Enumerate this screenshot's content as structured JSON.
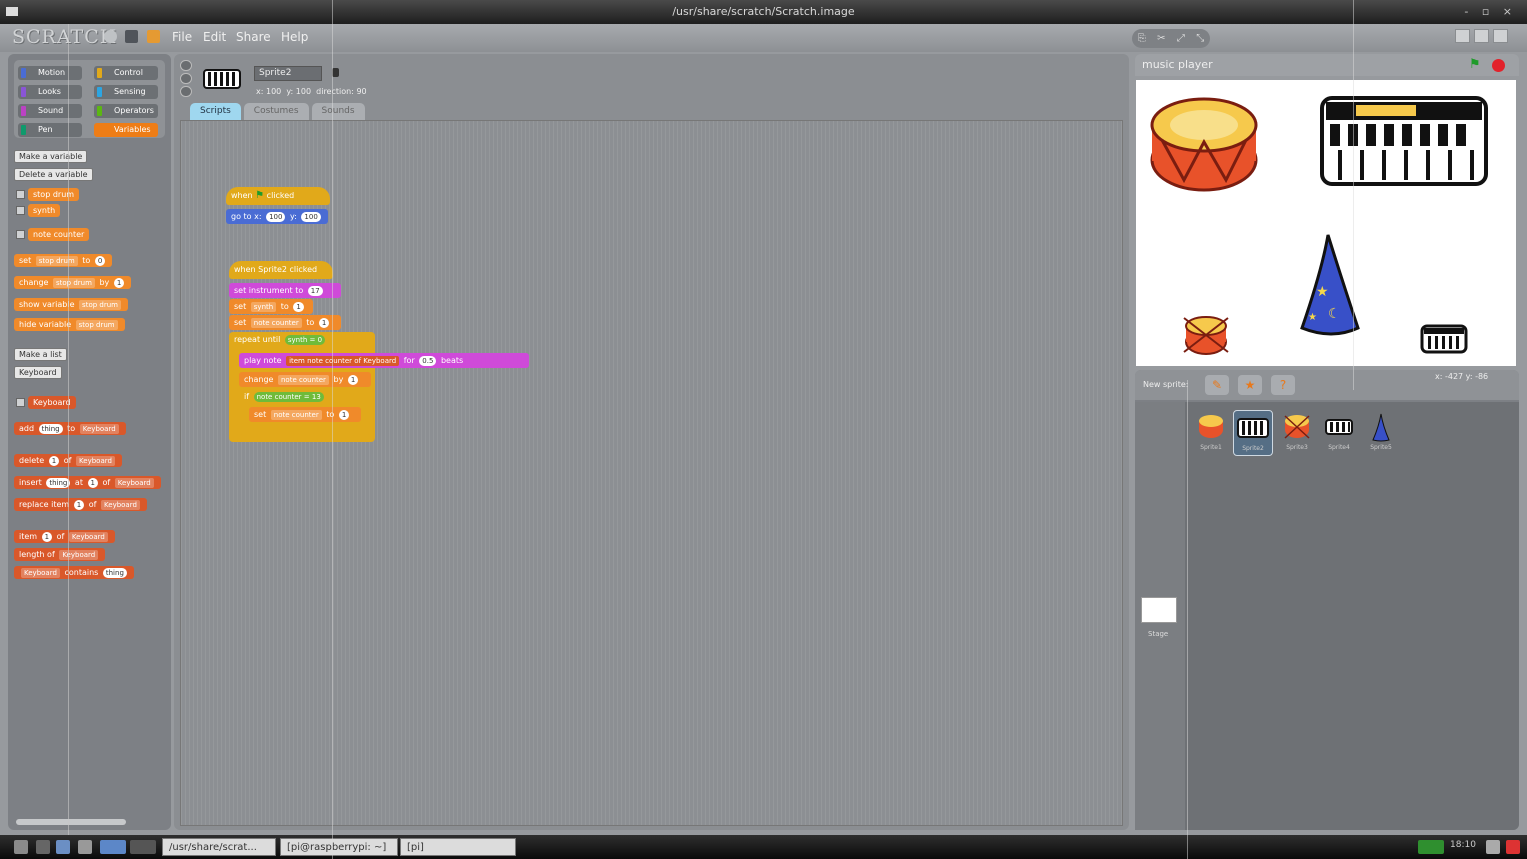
{
  "window": {
    "title": "/usr/share/scratch/Scratch.image"
  },
  "app": {
    "logo": "SCRATCH"
  },
  "menu": {
    "items": [
      "File",
      "Edit",
      "Share",
      "Help"
    ]
  },
  "categories": [
    {
      "label": "Motion",
      "color": "#4a6cd4"
    },
    {
      "label": "Control",
      "color": "#e1a91a"
    },
    {
      "label": "Looks",
      "color": "#8a55d7"
    },
    {
      "label": "Sensing",
      "color": "#2ca5e2"
    },
    {
      "label": "Sound",
      "color": "#bb42c3"
    },
    {
      "label": "Operators",
      "color": "#5cb712"
    },
    {
      "label": "Pen",
      "color": "#0e9a6c"
    },
    {
      "label": "Variables",
      "color": "#ee7d16"
    }
  ],
  "palette": {
    "make_variable": "Make a variable",
    "delete_variable": "Delete a variable",
    "vars": [
      "stop drum",
      "synth",
      "note counter"
    ],
    "set_block": "set",
    "set_var": "stop drum",
    "set_to": "to",
    "set_val": "0",
    "change_block": "change",
    "change_var": "stop drum",
    "change_by": "by",
    "change_val": "1",
    "show_block": "show variable",
    "show_var": "stop drum",
    "hide_block": "hide variable",
    "hide_var": "stop drum",
    "make_list": "Make a list",
    "delete_list": "Keyboard",
    "list_name": "Keyboard",
    "add_block": "add",
    "add_thing": "thing",
    "add_to": "to",
    "add_list": "Keyboard",
    "delete_block": "delete",
    "delete_idx": "1",
    "delete_of": "of",
    "insert_block": "insert",
    "insert_thing": "thing",
    "insert_at": "at",
    "insert_idx": "1",
    "insert_of": "of",
    "insert_list": "Keyboard",
    "replace_block": "replace item",
    "replace_idx": "1",
    "replace_of": "of",
    "replace_list": "Keyboard",
    "item_block": "item",
    "item_idx": "1",
    "item_of": "of",
    "item_list": "Keyboard",
    "length_block": "length of",
    "length_list": "Keyboard",
    "contains_list": "Keyboard",
    "contains_block": "contains",
    "contains_thing": "thing"
  },
  "sprite": {
    "name": "Sprite2",
    "x_label": "x:",
    "x_val": "100",
    "y_label": "y:",
    "y_val": "100",
    "dir_label": "direction:",
    "dir_val": "90"
  },
  "tabs": [
    "Scripts",
    "Costumes",
    "Sounds"
  ],
  "script": {
    "when_flag": "when",
    "flag_clicked": "clicked",
    "goto": "go to x:",
    "goto_x": "100",
    "goto_y_label": "y:",
    "goto_y": "100",
    "when_sprite": "when Sprite2 clicked",
    "set_instrument": "set instrument to",
    "instrument": "17",
    "set1": "set",
    "set1_var": "synth",
    "set1_to": "to",
    "set1_val": "1",
    "set2": "set",
    "set2_var": "note counter",
    "set2_to": "to",
    "set2_val": "1",
    "repeat_until": "repeat until",
    "repeat_var": "synth",
    "repeat_eq": "=",
    "repeat_val": "0",
    "play_note": "play note",
    "item": "item",
    "note_counter": "note counter",
    "of": "of",
    "list": "Keyboard",
    "for": "for",
    "beats": "0.5",
    "beats_label": "beats",
    "change": "change",
    "change_var": "note counter",
    "change_by": "by",
    "change_val": "1",
    "if": "if",
    "if_var": "note counter",
    "if_eq": "=",
    "if_val": "13",
    "set3": "set",
    "set3_var": "note counter",
    "set3_to": "to",
    "set3_val": "1"
  },
  "stage": {
    "title": "music player",
    "coords": "x: -427   y: -86"
  },
  "corral": {
    "new_sprite": "New sprite:",
    "sprites": [
      "Sprite1",
      "Sprite2",
      "Sprite3",
      "Sprite4",
      "Sprite5"
    ],
    "selected": "Sprite2",
    "stage_label": "Stage"
  },
  "taskbar": {
    "apps": [
      "/usr/share/scrat...",
      "[pi@raspberrypi: ~]",
      "[pi]"
    ],
    "clock": "18:10"
  }
}
